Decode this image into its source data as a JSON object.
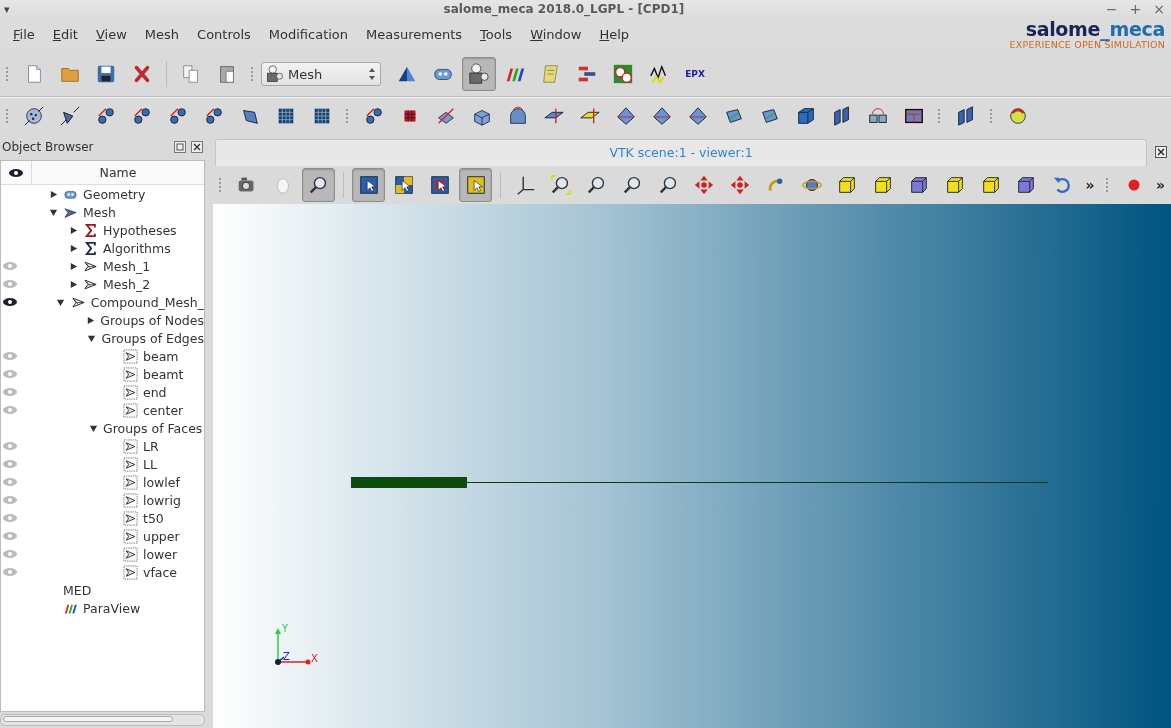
{
  "window": {
    "menu_glyph": "▾",
    "title": "salome_meca 2018.0_LGPL - [CPD1]",
    "controls": [
      "−",
      "+",
      "×"
    ]
  },
  "menu": [
    {
      "label": "File",
      "mnemonic": true
    },
    {
      "label": "Edit",
      "mnemonic": true
    },
    {
      "label": "View",
      "mnemonic": true
    },
    {
      "label": "Mesh",
      "mnemonic": false
    },
    {
      "label": "Controls",
      "mnemonic": false
    },
    {
      "label": "Modification",
      "mnemonic": false
    },
    {
      "label": "Measurements",
      "mnemonic": false
    },
    {
      "label": "Tools",
      "mnemonic": true
    },
    {
      "label": "Window",
      "mnemonic": true
    },
    {
      "label": "Help",
      "mnemonic": true
    }
  ],
  "logo": {
    "word_a": "salome",
    "word_b": "_meca",
    "tagline": "EXPERIENCE OPEN SIMULATION"
  },
  "main_toolbar": {
    "module_combo": {
      "value": "Mesh"
    },
    "module_buttons": [
      {
        "selected": false
      },
      {
        "selected": false
      },
      {
        "selected": true
      },
      {
        "selected": false
      },
      {
        "selected": false
      },
      {
        "selected": false
      },
      {
        "selected": false
      },
      {
        "selected": false
      }
    ],
    "epx_label": "EPX"
  },
  "object_browser": {
    "title": "Object Browser",
    "name_column": "Name",
    "tree": [
      {
        "name": "Geometry",
        "kind": "geometry",
        "expanded": false
      },
      {
        "name": "Mesh",
        "kind": "mesh",
        "expanded": true,
        "children": [
          {
            "name": "Hypotheses",
            "kind": "hypotheses",
            "expanded": false
          },
          {
            "name": "Algorithms",
            "kind": "algorithms",
            "expanded": false
          },
          {
            "name": "Mesh_1",
            "kind": "submesh",
            "visible": false,
            "expanded": false
          },
          {
            "name": "Mesh_2",
            "kind": "submesh",
            "visible": false,
            "expanded": false
          },
          {
            "name": "Compound_Mesh_",
            "kind": "submesh",
            "visible": true,
            "expanded": true,
            "children": [
              {
                "name": "Groups of Nodes",
                "expanded": false
              },
              {
                "name": "Groups of Edges",
                "expanded": true,
                "children": [
                  {
                    "name": "beam",
                    "kind": "group",
                    "visible": false
                  },
                  {
                    "name": "beamt",
                    "kind": "group",
                    "visible": false
                  },
                  {
                    "name": "end",
                    "kind": "group",
                    "visible": false
                  },
                  {
                    "name": "center",
                    "kind": "group",
                    "visible": false
                  }
                ]
              },
              {
                "name": "Groups of Faces",
                "expanded": true,
                "children": [
                  {
                    "name": "LR",
                    "kind": "group",
                    "visible": false
                  },
                  {
                    "name": "LL",
                    "kind": "group",
                    "visible": false
                  },
                  {
                    "name": "lowlef",
                    "kind": "group",
                    "visible": false
                  },
                  {
                    "name": "lowrig",
                    "kind": "group",
                    "visible": false
                  },
                  {
                    "name": "t50",
                    "kind": "group",
                    "visible": false
                  },
                  {
                    "name": "upper",
                    "kind": "group",
                    "visible": false
                  },
                  {
                    "name": "lower",
                    "kind": "group",
                    "visible": false
                  },
                  {
                    "name": "vface",
                    "kind": "group",
                    "visible": false
                  }
                ]
              }
            ]
          }
        ]
      },
      {
        "name": "MED"
      },
      {
        "name": "ParaView",
        "kind": "paraview"
      }
    ]
  },
  "viewer": {
    "tab": "VTK scene:1 - viewer:1",
    "toolbar_buttons": [
      {
        "selected": false
      },
      {
        "selected": false
      },
      {
        "selected": true
      },
      {
        "selected": true
      },
      {
        "selected": false
      },
      {
        "selected": false
      },
      {
        "selected": true
      },
      {
        "selected": false
      },
      {
        "selected": false
      },
      {
        "selected": false
      },
      {
        "selected": false
      },
      {
        "selected": false
      },
      {
        "selected": false
      },
      {
        "selected": false
      },
      {
        "selected": false
      },
      {
        "selected": false
      },
      {
        "selected": false
      },
      {
        "selected": false
      },
      {
        "selected": false
      },
      {
        "selected": false
      },
      {
        "selected": false
      },
      {
        "selected": false
      },
      {
        "selected": false
      }
    ],
    "overflow_left": "»",
    "overflow_right": "»",
    "axes": {
      "x": "X",
      "y": "Y",
      "z": "Z"
    }
  }
}
